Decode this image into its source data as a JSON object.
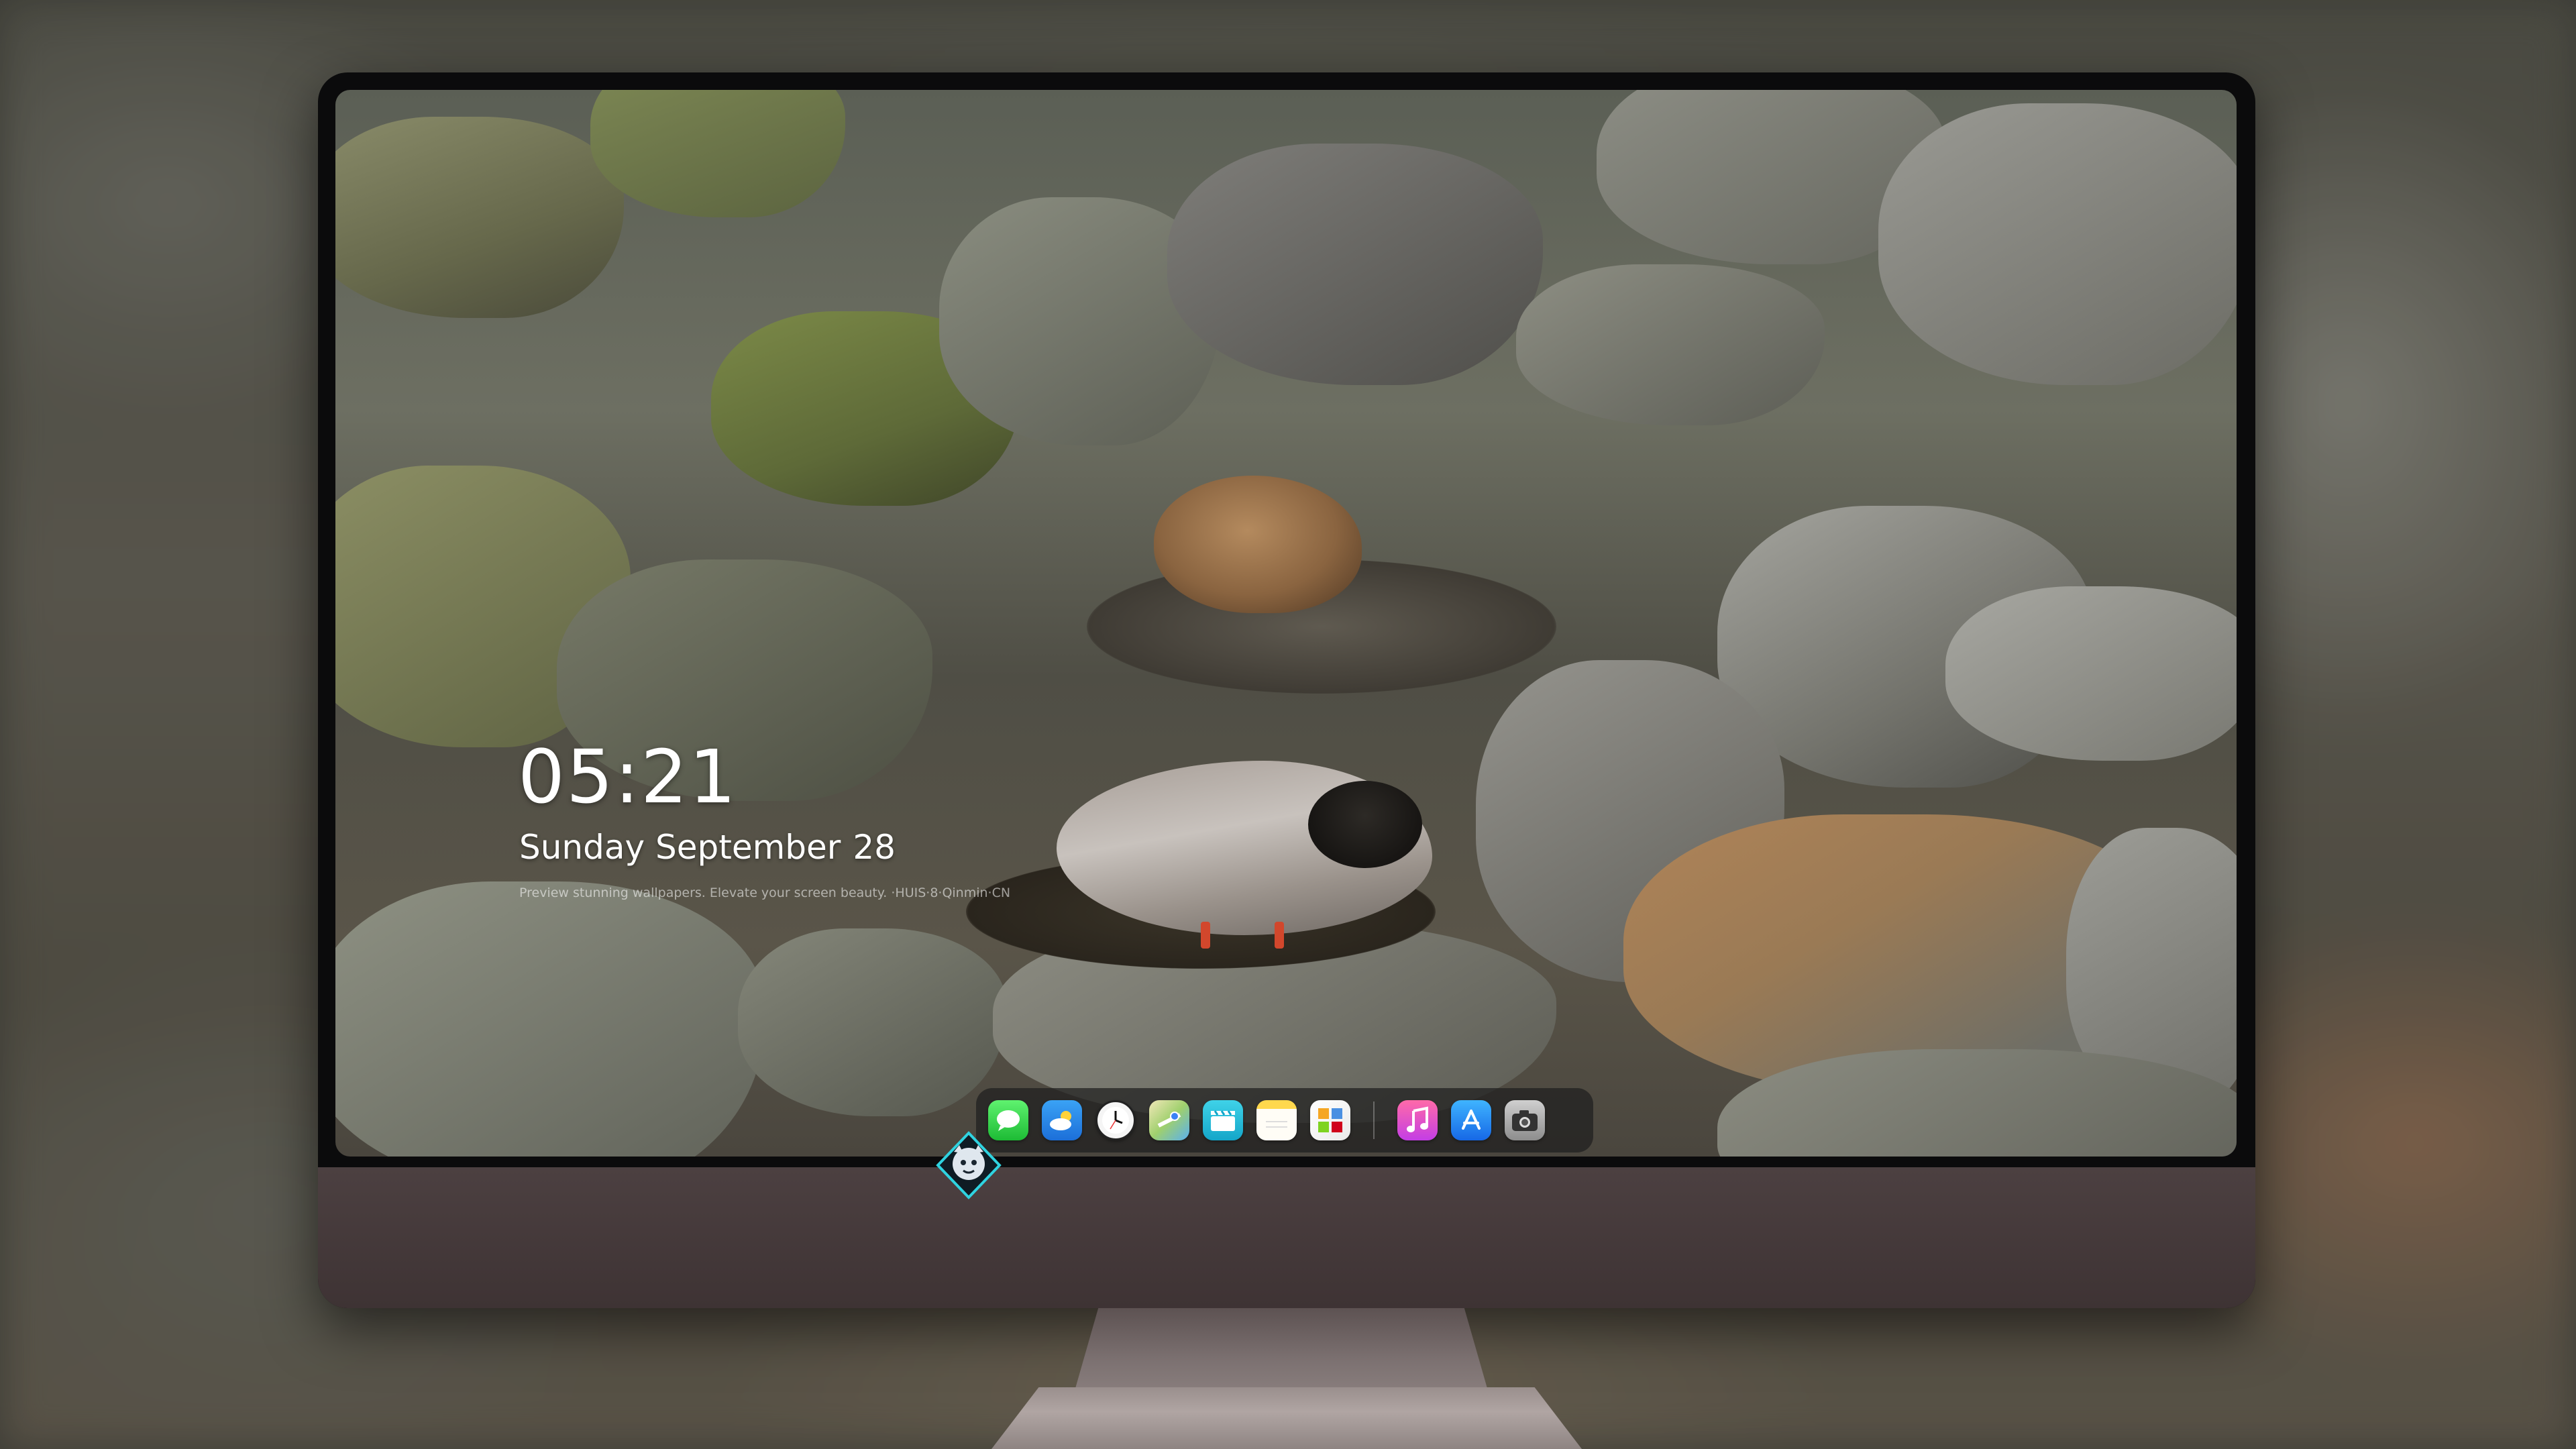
{
  "lock_screen": {
    "time": "05:21",
    "weekday_month": "Sunday September",
    "day": "28",
    "caption": "Preview stunning wallpapers. Elevate your screen beauty. ·HUIS·8·Qinmin·CN"
  },
  "dock": {
    "apps": [
      {
        "name": "Messages",
        "icon": "messages-icon"
      },
      {
        "name": "Weather",
        "icon": "weather-icon"
      },
      {
        "name": "Clock",
        "icon": "clock-icon"
      },
      {
        "name": "Maps",
        "icon": "maps-icon"
      },
      {
        "name": "Clips",
        "icon": "clips-icon"
      },
      {
        "name": "Notes",
        "icon": "notes-icon"
      },
      {
        "name": "Photos",
        "icon": "photos-icon"
      },
      {
        "name": "Music",
        "icon": "music-icon"
      },
      {
        "name": "App Store",
        "icon": "app-store-icon"
      },
      {
        "name": "Camera",
        "icon": "camera-icon"
      }
    ]
  },
  "colors": {
    "bezel": "#0b0b0c",
    "chin": "#4c4041",
    "accent_logo": "#2fd3e0"
  }
}
